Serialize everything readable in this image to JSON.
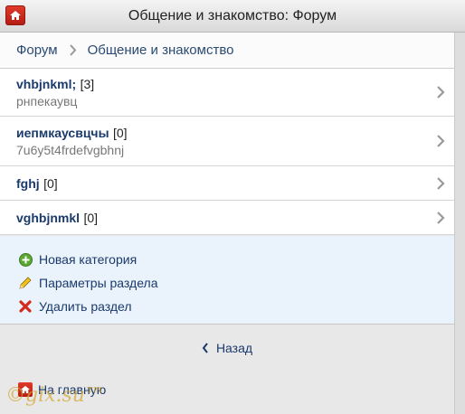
{
  "header": {
    "title": "Общение и знакомство: Форум",
    "home_icon": "home-icon"
  },
  "breadcrumb": {
    "items": [
      "Форум",
      "Общение и знакомство"
    ]
  },
  "topics": [
    {
      "title": "vhbjnkml;",
      "count": "[3]",
      "desc": "рнпекаувц"
    },
    {
      "title": "иепмкаусвцчы",
      "count": "[0]",
      "desc": "7u6y5t4frdefvgbhnj"
    },
    {
      "title": "fghj",
      "count": "[0]",
      "desc": ""
    },
    {
      "title": "vghbjnmkl",
      "count": "[0]",
      "desc": ""
    }
  ],
  "actions": {
    "new_category": "Новая категория",
    "section_params": "Параметры раздела",
    "delete_section": "Удалить раздел"
  },
  "back_label": "Назад",
  "home_label": "На главную",
  "watermark": "©gix.su™",
  "colors": {
    "link": "#1a3a6b",
    "home_red": "#c8281a",
    "actions_bg": "#eaf2fb"
  }
}
